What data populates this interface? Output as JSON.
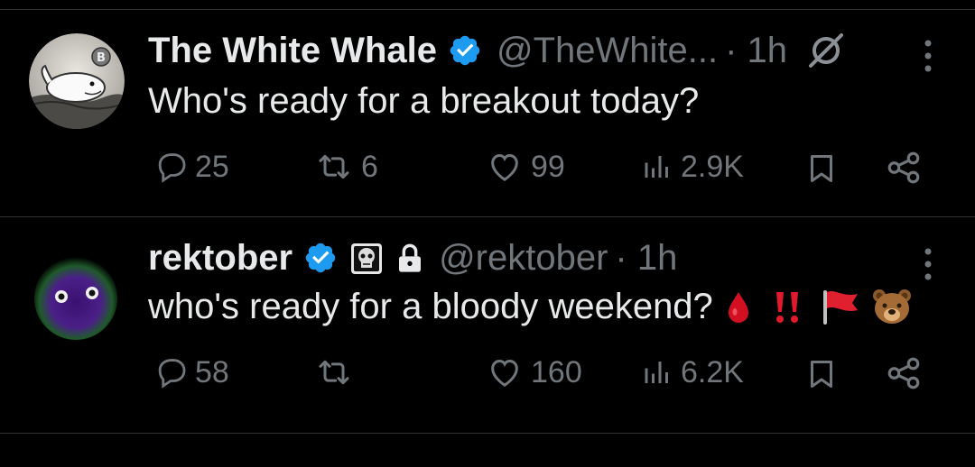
{
  "tweets": [
    {
      "name": "The White Whale",
      "handle": "@TheWhite...",
      "time": "· 1h",
      "text": "Who's ready for a breakout today?",
      "replies": "25",
      "retweets": "6",
      "likes": "99",
      "views": "2.9K"
    },
    {
      "name": "rektober",
      "handle": "@rektober",
      "time": "· 1h",
      "text": "who's ready for a bloody weekend?",
      "replies": "58",
      "retweets": "",
      "likes": "160",
      "views": "6.2K"
    }
  ],
  "colors": {
    "background": "#000000",
    "text": "#e7e9ea",
    "muted": "#71767b",
    "verified": "#1d9bf0",
    "divider": "#2f3336"
  },
  "icons": {
    "reply": "speech-bubble-icon",
    "retweet": "retweet-arrows-icon",
    "like": "heart-icon",
    "views": "bar-chart-icon",
    "bookmark": "bookmark-icon",
    "share": "share-icon",
    "more": "vertical-dots-icon",
    "grok": "grok-slash-icon",
    "verified": "verified-badge-icon"
  }
}
